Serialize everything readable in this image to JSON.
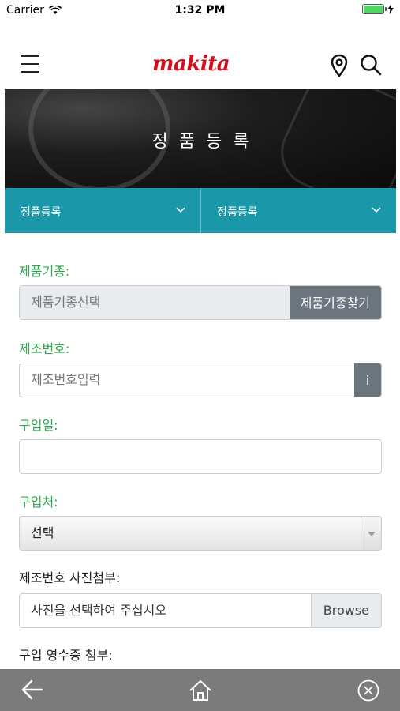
{
  "status_bar": {
    "carrier": "Carrier",
    "time": "1:32 PM"
  },
  "header": {
    "logo_text": "makita",
    "brand_color": "#d4101f",
    "menu_icon": "hamburger-icon",
    "location_icon": "map-pin-icon",
    "search_icon": "search-icon"
  },
  "banner": {
    "title": "정품등록"
  },
  "nav": {
    "accent_color": "#1a97a8",
    "dropdowns": [
      {
        "label": "정품등록"
      },
      {
        "label": "정품등록"
      }
    ]
  },
  "form": {
    "label_color": "#2fa84f",
    "product_model": {
      "label": "제품기종:",
      "placeholder": "제품기종선택",
      "button": "제품기종찾기"
    },
    "serial_number": {
      "label": "제조번호:",
      "placeholder": "제조번호입력",
      "info_button": "i"
    },
    "purchase_date": {
      "label": "구입일:",
      "value": ""
    },
    "purchase_place": {
      "label": "구입처:",
      "selected": "선택"
    },
    "serial_photo": {
      "label": "제조번호 사진첨부:",
      "placeholder": "사진을 선택하여 주십시오",
      "button": "Browse"
    },
    "receipt": {
      "label": "구입 영수증 첨부:"
    }
  },
  "bottom_bar": {
    "back_icon": "arrow-left-icon",
    "home_icon": "home-icon",
    "close_icon": "close-circle-icon"
  }
}
